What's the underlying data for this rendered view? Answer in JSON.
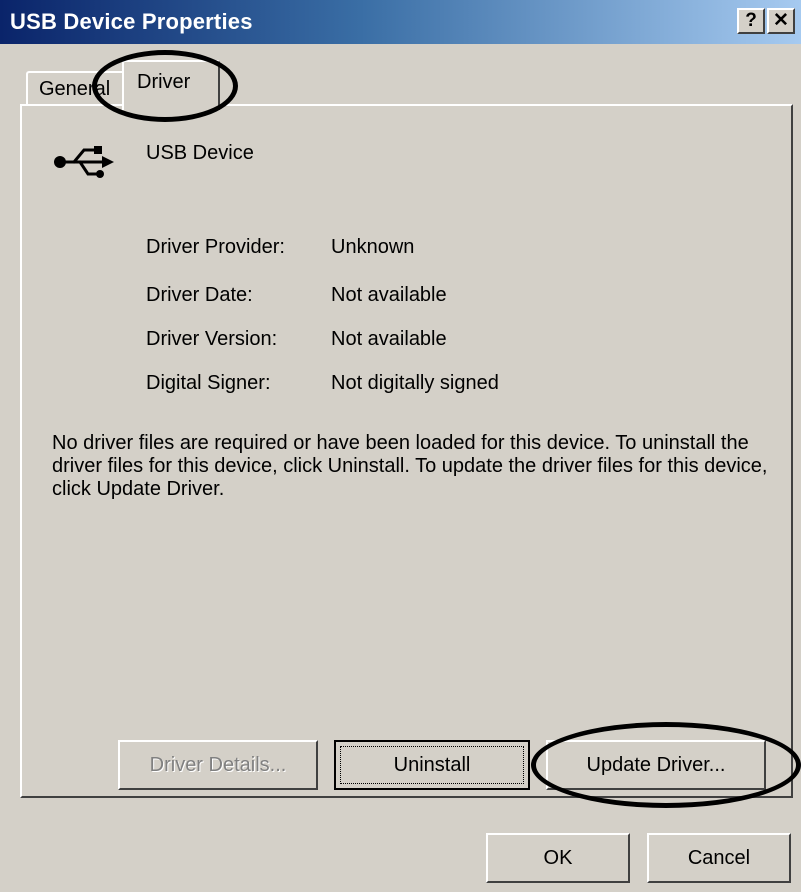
{
  "window": {
    "title": "USB Device Properties",
    "help_glyph": "?",
    "close_glyph": "✕"
  },
  "tabs": [
    {
      "label": "General",
      "active": false
    },
    {
      "label": "Driver",
      "active": true
    }
  ],
  "device": {
    "name": "USB Device",
    "icon": "usb-icon"
  },
  "properties": [
    {
      "label": "Driver Provider:",
      "value": "Unknown"
    },
    {
      "label": "Driver Date:",
      "value": "Not available"
    },
    {
      "label": "Driver Version:",
      "value": "Not available"
    },
    {
      "label": "Digital Signer:",
      "value": "Not digitally signed"
    }
  ],
  "description": "No driver files are required or have been loaded for this device. To uninstall the driver files for this device, click Uninstall. To update the driver files for this device, click Update Driver.",
  "buttons": {
    "driver_details": "Driver Details...",
    "uninstall": "Uninstall",
    "update_driver": "Update Driver...",
    "ok": "OK",
    "cancel": "Cancel"
  },
  "colors": {
    "dialog_face": "#d4d0c8",
    "title_active": "#0a246a",
    "annotation": "#000000"
  }
}
